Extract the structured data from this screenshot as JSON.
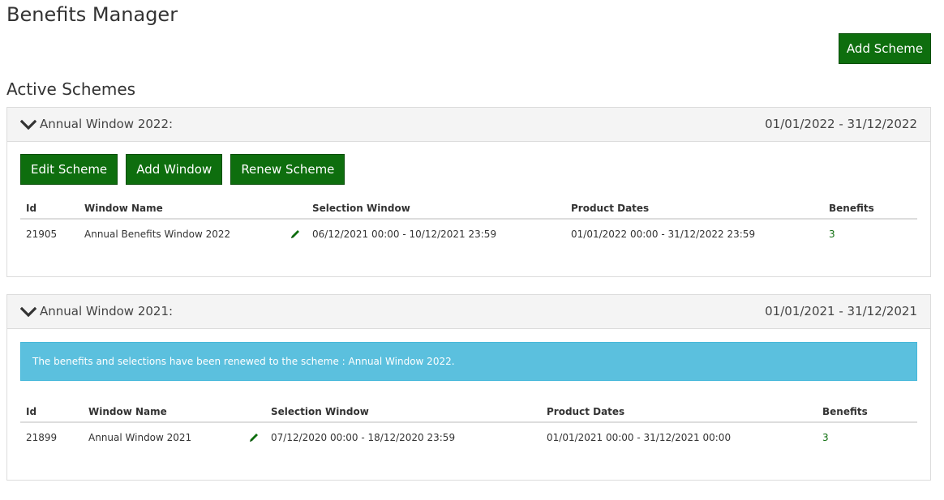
{
  "header": {
    "title": "Benefits Manager",
    "add_scheme_label": "Add Scheme"
  },
  "section": {
    "title": "Active Schemes"
  },
  "colors": {
    "primary_button": "#0e6e0e",
    "alert_bg": "#5bc0de",
    "link": "#0e6e0e"
  },
  "icons": {
    "expand": "chevron-down-icon",
    "edit": "pencil-icon"
  },
  "schemes": [
    {
      "name": "Annual Window 2022:",
      "dates": "01/01/2022 - 31/12/2022",
      "buttons": {
        "edit": "Edit Scheme",
        "add_window": "Add Window",
        "renew": "Renew Scheme"
      },
      "columns": [
        "Id",
        "Window Name",
        "Selection Window",
        "Product Dates",
        "Benefits"
      ],
      "rows": [
        {
          "id": "21905",
          "window_name": "Annual Benefits Window 2022",
          "selection_window": "06/12/2021 00:00 - 10/12/2021 23:59",
          "product_dates": "01/01/2022 00:00 - 31/12/2022 23:59",
          "benefits": "3"
        }
      ]
    },
    {
      "name": "Annual Window 2021:",
      "dates": "01/01/2021 - 31/12/2021",
      "alert": "The benefits and selections have been renewed to the scheme : Annual Window 2022.",
      "columns": [
        "Id",
        "Window Name",
        "Selection Window",
        "Product Dates",
        "Benefits"
      ],
      "rows": [
        {
          "id": "21899",
          "window_name": "Annual Window 2021",
          "selection_window": "07/12/2020 00:00 - 18/12/2020 23:59",
          "product_dates": "01/01/2021 00:00 - 31/12/2021 00:00",
          "benefits": "3"
        }
      ]
    }
  ]
}
